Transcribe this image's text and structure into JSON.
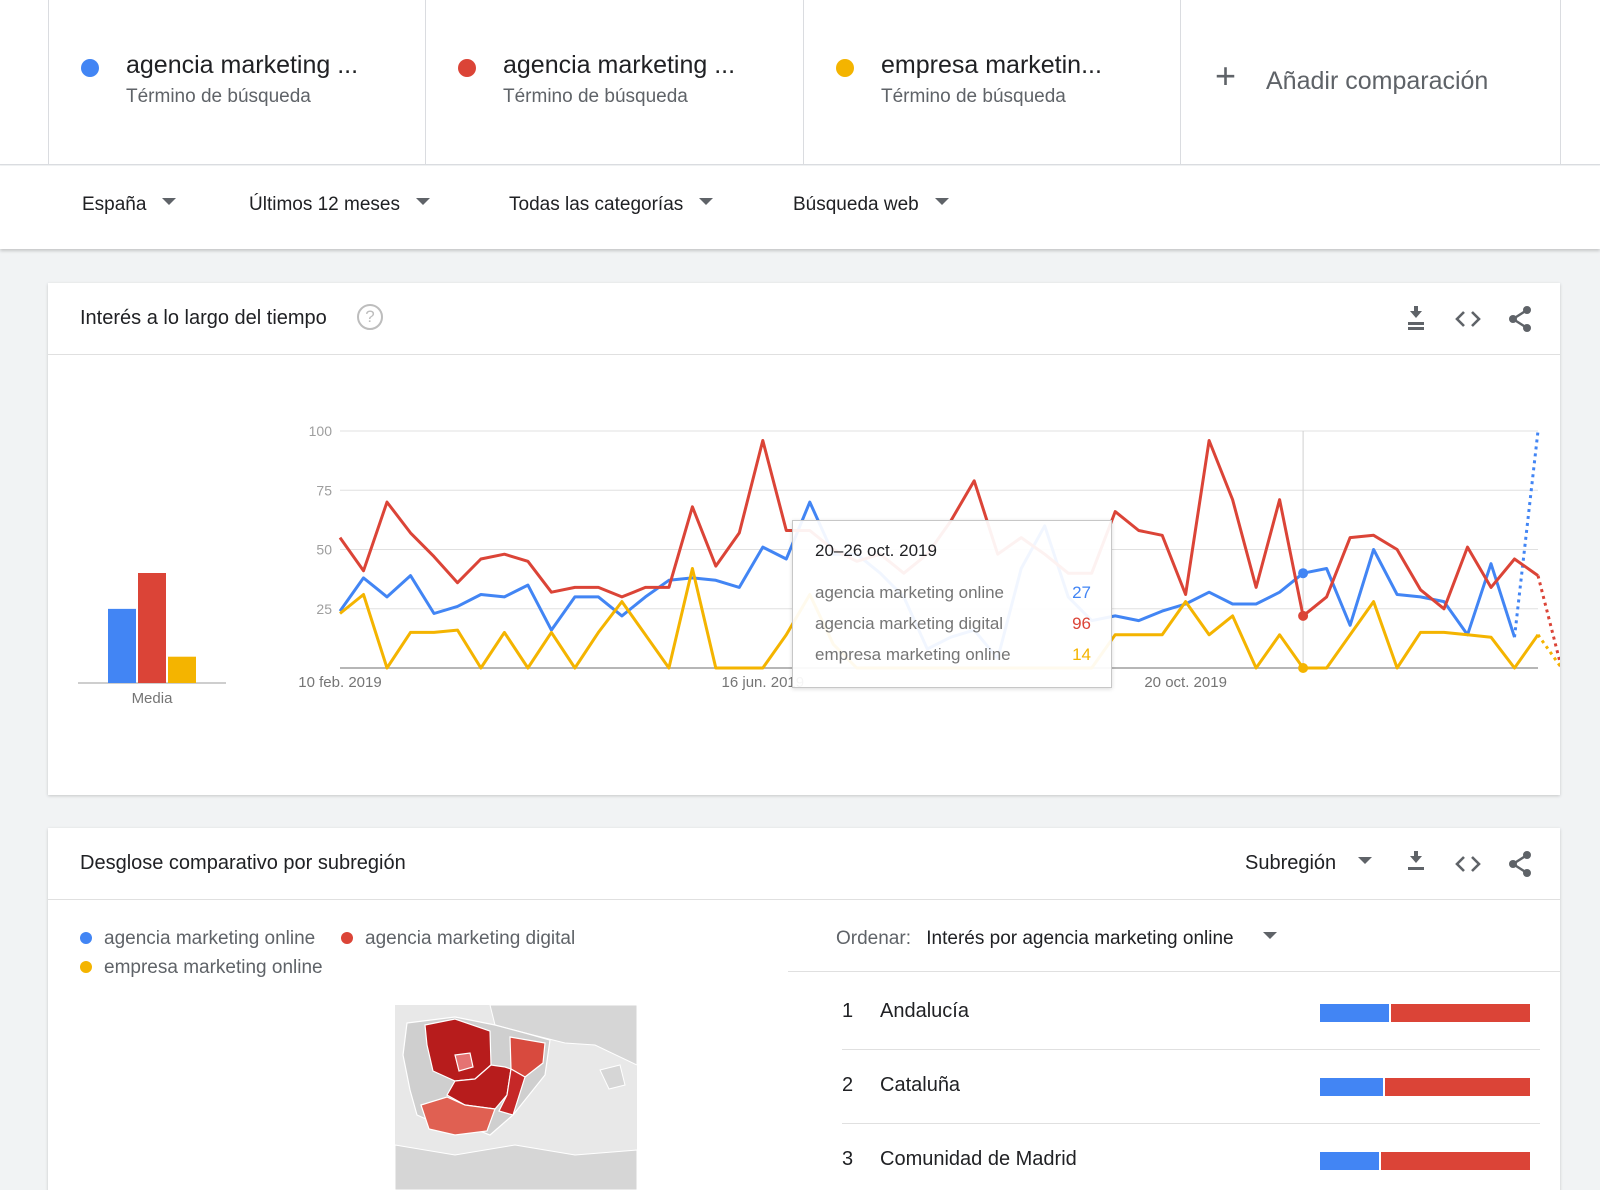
{
  "header": {
    "terms": [
      {
        "name": "agencia marketing ...",
        "type": "Término de búsqueda",
        "color": "#4285f4"
      },
      {
        "name": "agencia marketing ...",
        "type": "Término de búsqueda",
        "color": "#db4437"
      },
      {
        "name": "empresa marketin...",
        "type": "Término de búsqueda",
        "color": "#f4b400"
      }
    ],
    "add_comparison": "Añadir comparación"
  },
  "filters": {
    "region": "España",
    "period": "Últimos 12 meses",
    "category": "Todas las categorías",
    "search_type": "Búsqueda web"
  },
  "interest_card": {
    "title": "Interés a lo largo del tiempo",
    "help": "?",
    "average_label": "Media",
    "tooltip": {
      "date": "20–26 oct. 2019",
      "rows": [
        {
          "label": "agencia marketing online",
          "value": "27",
          "color": "#4285f4"
        },
        {
          "label": "agencia marketing digital",
          "value": "96",
          "color": "#db4437"
        },
        {
          "label": "empresa marketing online",
          "value": "14",
          "color": "#f4b400"
        }
      ]
    }
  },
  "chart_data": {
    "type": "line",
    "ylim": [
      0,
      100
    ],
    "yticks": [
      "100",
      "75",
      "50",
      "25"
    ],
    "xtick_labels": [
      {
        "index": 0,
        "label": "10 feb. 2019"
      },
      {
        "index": 18,
        "label": "16 jun. 2019"
      },
      {
        "index": 36,
        "label": "20 oct. 2019"
      }
    ],
    "series": [
      {
        "name": "agencia marketing online",
        "color": "#4285f4",
        "average": 31,
        "values": [
          24,
          38,
          30,
          39,
          23,
          26,
          31,
          30,
          35,
          16,
          30,
          30,
          22,
          30,
          37,
          38,
          37,
          34,
          51,
          46,
          70,
          48,
          48,
          40,
          30,
          8,
          13,
          16,
          4,
          42,
          60,
          30,
          20,
          22,
          20,
          24,
          27,
          32,
          27,
          27,
          32,
          40,
          42,
          18,
          50,
          31,
          30,
          28,
          14,
          44,
          13,
          100
        ]
      },
      {
        "name": "agencia marketing digital",
        "color": "#db4437",
        "average": 46,
        "values": [
          55,
          41,
          70,
          57,
          47,
          36,
          46,
          48,
          45,
          32,
          34,
          34,
          30,
          34,
          34,
          68,
          43,
          57,
          96,
          58,
          58,
          50,
          45,
          48,
          40,
          48,
          62,
          79,
          48,
          55,
          48,
          40,
          40,
          66,
          58,
          56,
          31,
          96,
          71,
          34,
          71,
          22,
          30,
          55,
          56,
          50,
          33,
          25,
          51,
          34,
          46,
          39,
          0
        ]
      },
      {
        "name": "empresa marketing online",
        "color": "#f4b400",
        "average": 11,
        "values": [
          23,
          31,
          0,
          15,
          15,
          16,
          0,
          15,
          0,
          15,
          0,
          15,
          28,
          14,
          0,
          42,
          0,
          0,
          0,
          14,
          31,
          10,
          0,
          0,
          0,
          0,
          0,
          0,
          0,
          0,
          0,
          0,
          0,
          14,
          14,
          14,
          28,
          14,
          22,
          0,
          14,
          0,
          0,
          14,
          28,
          0,
          15,
          15,
          14,
          13,
          0,
          14,
          0
        ]
      }
    ]
  },
  "subregion_card": {
    "title": "Desglose comparativo por subregión",
    "scope": "Subregión",
    "legend": [
      {
        "label": "agencia marketing online",
        "color": "#4285f4"
      },
      {
        "label": "agencia marketing digital",
        "color": "#db4437"
      },
      {
        "label": "empresa marketing online",
        "color": "#f4b400"
      }
    ],
    "order_label": "Ordenar:",
    "order_value": "Interés por agencia marketing online",
    "rows": [
      {
        "rank": "1",
        "name": "Andalucía",
        "online_share": 0.33,
        "digital_share": 0.67
      },
      {
        "rank": "2",
        "name": "Cataluña",
        "online_share": 0.3,
        "digital_share": 0.7
      },
      {
        "rank": "3",
        "name": "Comunidad de Madrid",
        "online_share": 0.28,
        "digital_share": 0.72
      }
    ]
  }
}
